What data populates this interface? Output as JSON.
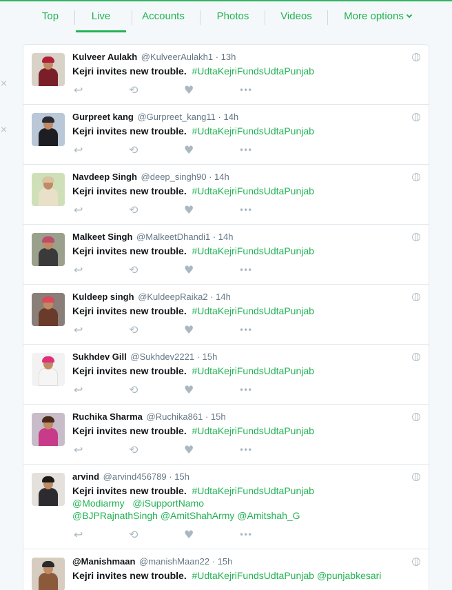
{
  "nav": {
    "tabs": [
      {
        "label": "Top"
      },
      {
        "label": "Live"
      },
      {
        "label": "Accounts"
      },
      {
        "label": "Photos"
      },
      {
        "label": "Videos"
      },
      {
        "label": "More options"
      }
    ],
    "active_tab": "Live"
  },
  "icons": {
    "reply": "↩",
    "retweet": "⟲",
    "like": "♥",
    "more": "•••",
    "dismiss": "×"
  },
  "colors": {
    "accent": "#22b254",
    "text": "#14171a",
    "muted": "#657786",
    "action": "#aab8c2"
  },
  "tweets": [
    {
      "name": "Kulveer Aulakh",
      "handle": "@KulveerAulakh1",
      "time": "· 13h",
      "text": "Kejri invites new trouble.",
      "tags": "#UdtaKejriFundsUdtaPunjab",
      "extra1": "",
      "extra2": ""
    },
    {
      "name": "Gurpreet kang",
      "handle": "@Gurpreet_kang11",
      "time": "· 14h",
      "text": "Kejri invites new trouble.",
      "tags": "#UdtaKejriFundsUdtaPunjab",
      "extra1": "",
      "extra2": ""
    },
    {
      "name": "Navdeep Singh",
      "handle": "@deep_singh90",
      "time": "· 14h",
      "text": "Kejri invites new trouble.",
      "tags": "#UdtaKejriFundsUdtaPunjab",
      "extra1": "",
      "extra2": ""
    },
    {
      "name": "Malkeet Singh",
      "handle": "@MalkeetDhandi1",
      "time": "· 14h",
      "text": "Kejri invites new trouble.",
      "tags": "#UdtaKejriFundsUdtaPunjab",
      "extra1": "",
      "extra2": ""
    },
    {
      "name": "Kuldeep singh",
      "handle": "@KuldeepRaika2",
      "time": "· 14h",
      "text": "Kejri invites new trouble.",
      "tags": "#UdtaKejriFundsUdtaPunjab",
      "extra1": "",
      "extra2": ""
    },
    {
      "name": "Sukhdev Gill",
      "handle": "@Sukhdev2221",
      "time": "· 15h",
      "text": "Kejri invites new trouble.",
      "tags": "#UdtaKejriFundsUdtaPunjab",
      "extra1": "",
      "extra2": ""
    },
    {
      "name": "Ruchika Sharma",
      "handle": "@Ruchika861",
      "time": "· 15h",
      "text": "Kejri invites new trouble.",
      "tags": "#UdtaKejriFundsUdtaPunjab",
      "extra1": "",
      "extra2": ""
    },
    {
      "name": "arvind",
      "handle": "@arvind456789",
      "time": "· 15h",
      "text": "Kejri invites new trouble.",
      "tags": "#UdtaKejriFundsUdtaPunjab",
      "extra1": "@Modiarmy   @iSupportNamo",
      "extra2": "@BJPRajnathSingh @AmitShahArmy @Amitshah_G"
    },
    {
      "name": "@Manishmaan",
      "handle": "@manishMaan22",
      "time": "· 15h",
      "text": "Kejri invites new trouble.",
      "tags": "#UdtaKejriFundsUdtaPunjab @punjabkesari",
      "extra1": "",
      "extra2": ""
    }
  ]
}
